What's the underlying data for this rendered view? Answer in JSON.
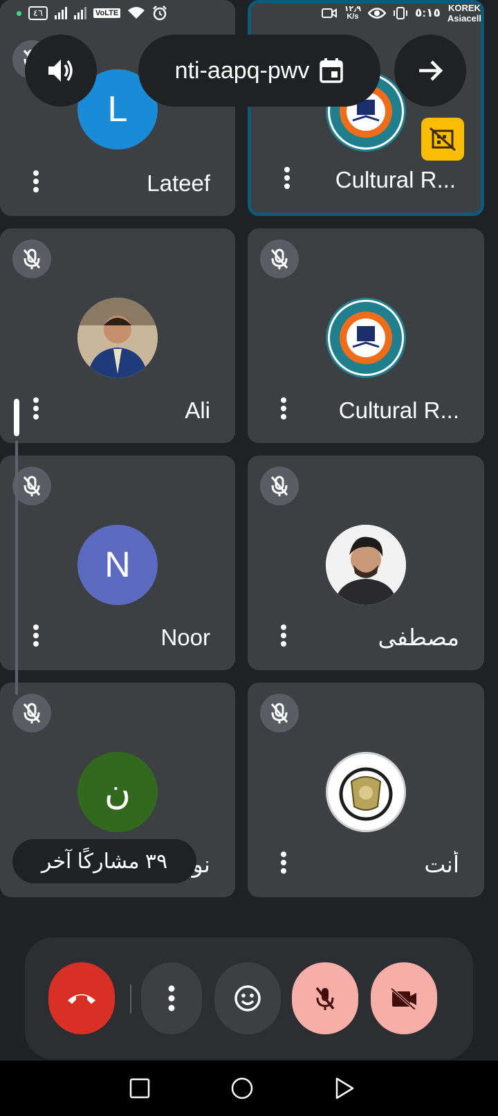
{
  "status_bar": {
    "battery": "٤٦",
    "volte": "VoLTE",
    "speed_value": "١٢٫٩",
    "speed_unit": "K/s",
    "time": "٥:١٥",
    "carrier_line1": "KOREK",
    "carrier_line2": "Asiacell"
  },
  "top_bar": {
    "meeting_code": "nti-aapq-pwv"
  },
  "tiles": [
    {
      "name": "Lateef",
      "initial": "L",
      "avatar_color": "#1a8bd6"
    },
    {
      "name": "Cultural R..."
    },
    {
      "name": "Ali"
    },
    {
      "name": "Cultural R..."
    },
    {
      "name": "Noor",
      "initial": "N",
      "avatar_color": "#5c6bc0"
    },
    {
      "name": "مصطفى"
    },
    {
      "name": "نور",
      "initial": "ن",
      "avatar_color": "#33691e"
    },
    {
      "name": "أنت"
    }
  ],
  "others_pill": "٣٩ مشاركًا آخر",
  "colors": {
    "tile_bg": "#3c4043",
    "active_border": "#0b5a78",
    "end_call": "#d93025",
    "muted_ctrl": "#f6aea9",
    "share_badge": "#fbbc04"
  }
}
